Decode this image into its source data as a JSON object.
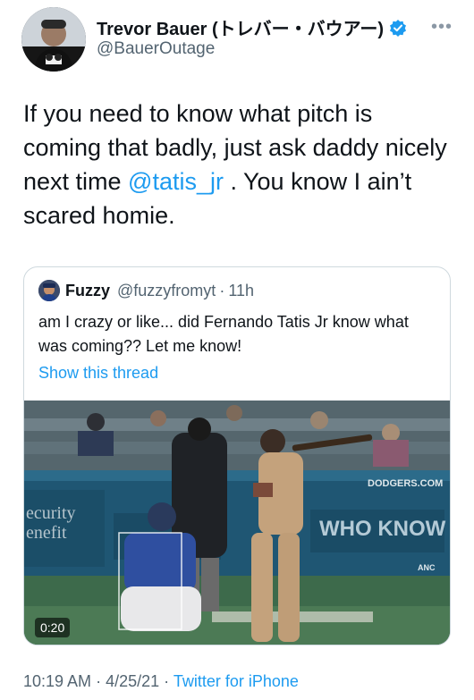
{
  "author": {
    "display_name": "Trevor Bauer (トレバー・バウアー)",
    "handle": "@BauerOutage",
    "verified": true,
    "avatar_icon": "profile-photo",
    "more_icon": "ellipsis-icon"
  },
  "tweet": {
    "text_before": "If you need to know what pitch is coming that badly, just ask daddy nicely next time ",
    "mention": "@tatis_jr",
    "text_after": " . You know I ain’t scared homie."
  },
  "quoted_tweet": {
    "display_name": "Fuzzy",
    "handle": "@fuzzyfromyt",
    "separator": "·",
    "time": "11h",
    "text": "am I crazy or like... did Fernando Tatis Jr know what was coming?? Let me know!",
    "show_thread_label": "Show this thread",
    "video": {
      "duration": "0:20",
      "banner_left": "ecurity\nenefit",
      "banner_right": "WHO KNOW",
      "wall_logo": "DODGERS.COM",
      "corner_tag": "ANC"
    }
  },
  "meta": {
    "time": "10:19 AM",
    "separator": "·",
    "date": "4/25/21",
    "source": "Twitter for iPhone"
  },
  "colors": {
    "link": "#1d9bf0",
    "secondary_text": "#536471",
    "border": "#cfd9de"
  }
}
